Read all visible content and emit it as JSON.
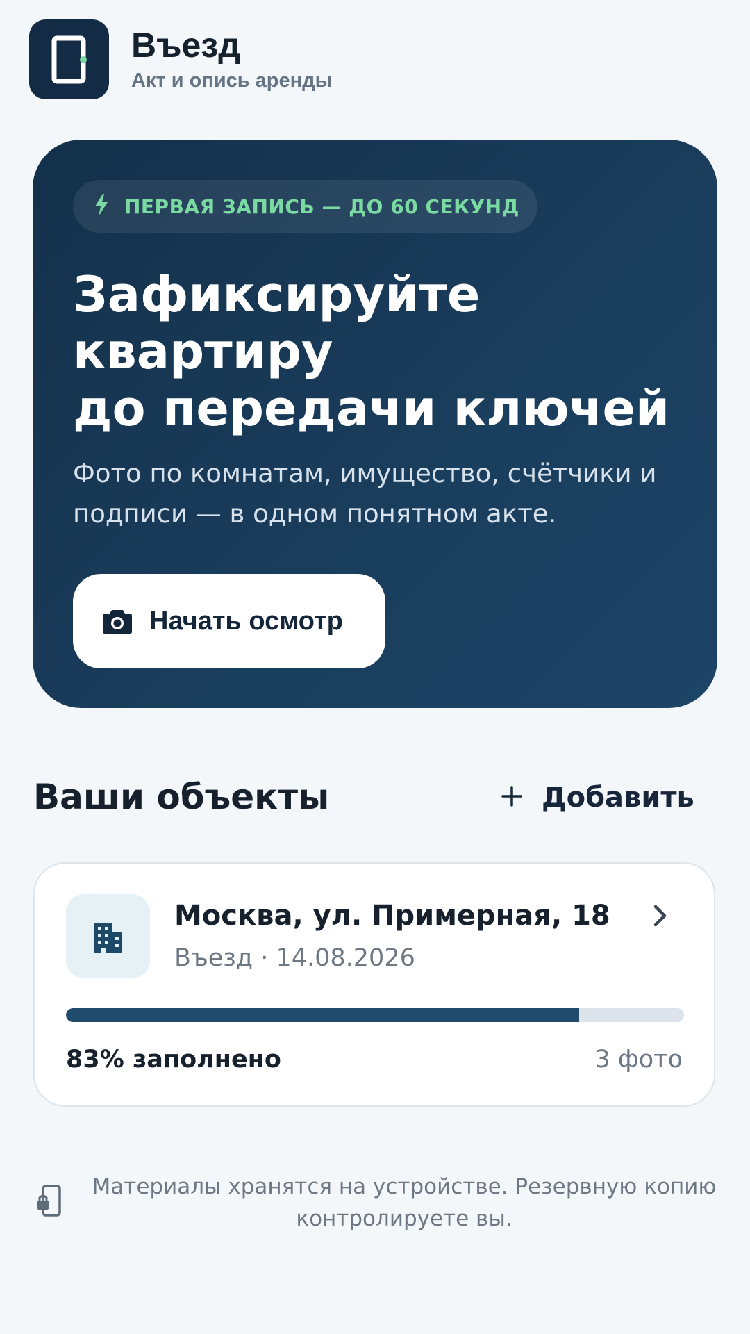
{
  "header": {
    "title": "Въезд",
    "subtitle": "Акт и опись аренды",
    "logo_icon": "door-icon"
  },
  "hero": {
    "badge": "ПЕРВАЯ ЗАПИСЬ — ДО 60 СЕКУНД",
    "badge_icon": "lightning-icon",
    "title_lines": [
      "Зафиксируйте",
      "квартиру",
      "до передачи ключей"
    ],
    "description_lines": [
      "Фото по комнатам, имущество, счётчики и",
      "подписи — в одном понятном акте."
    ],
    "button_label": "Начать осмотр",
    "button_icon": "camera-icon"
  },
  "objects": {
    "title": "Ваши объекты",
    "add_label": "Добавить",
    "add_icon": "plus-icon",
    "items": [
      {
        "icon": "building-icon",
        "address": "Москва, ул. Примерная, 18",
        "meta": "Въезд · 14.08.2026",
        "progress": 0.83,
        "progress_label": "83% заполнено",
        "photos": "3 фото"
      }
    ]
  },
  "footer": {
    "icon": "device-lock-icon",
    "note_lines": [
      "Материалы хранятся на устройстве. Резервную копию",
      "контролируете вы."
    ]
  },
  "colors": {
    "background": "#f3f7f9",
    "hero": "#1a3d5c",
    "accent_green": "#7bd9a2",
    "progress": "#204b6a"
  }
}
